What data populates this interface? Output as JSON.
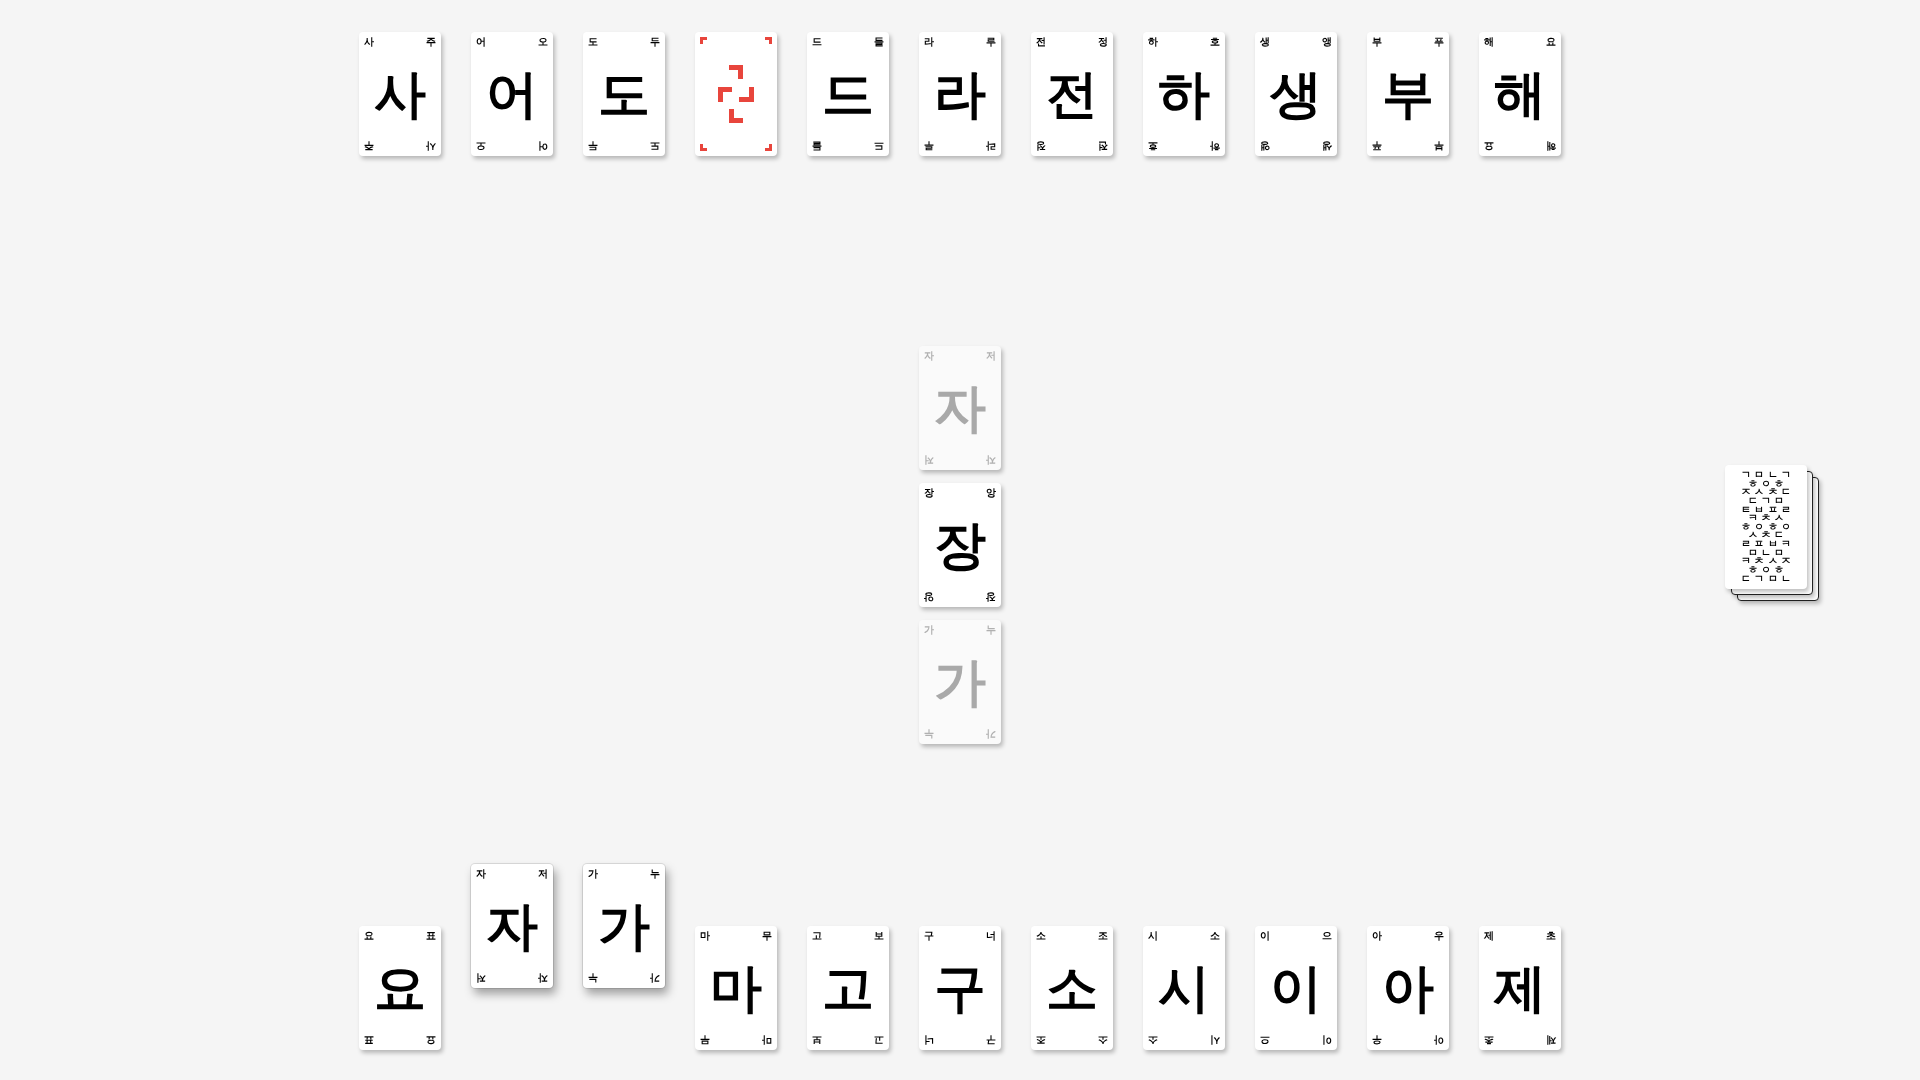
{
  "top_row": [
    {
      "kind": "letter",
      "syllable": "사",
      "corners": [
        "사",
        "주",
        "주",
        "사"
      ]
    },
    {
      "kind": "letter",
      "syllable": "어",
      "corners": [
        "어",
        "오",
        "오",
        "어"
      ]
    },
    {
      "kind": "letter",
      "syllable": "도",
      "corners": [
        "도",
        "두",
        "두",
        "도"
      ]
    },
    {
      "kind": "wild"
    },
    {
      "kind": "letter",
      "syllable": "드",
      "corners": [
        "드",
        "들",
        "들",
        "드"
      ]
    },
    {
      "kind": "letter",
      "syllable": "라",
      "corners": [
        "라",
        "루",
        "루",
        "라"
      ]
    },
    {
      "kind": "letter",
      "syllable": "전",
      "corners": [
        "전",
        "정",
        "정",
        "전"
      ]
    },
    {
      "kind": "letter",
      "syllable": "하",
      "corners": [
        "하",
        "호",
        "호",
        "하"
      ]
    },
    {
      "kind": "letter",
      "syllable": "생",
      "corners": [
        "생",
        "앵",
        "앵",
        "생"
      ]
    },
    {
      "kind": "letter",
      "syllable": "부",
      "corners": [
        "부",
        "푸",
        "푸",
        "부"
      ]
    },
    {
      "kind": "letter",
      "syllable": "해",
      "corners": [
        "해",
        "요",
        "요",
        "해"
      ]
    }
  ],
  "board": [
    {
      "kind": "letter",
      "syllable": "자",
      "corners": [
        "자",
        "저",
        "저",
        "자"
      ],
      "faded": true
    },
    {
      "kind": "letter",
      "syllable": "장",
      "corners": [
        "장",
        "앙",
        "앙",
        "장"
      ],
      "faded": false
    },
    {
      "kind": "letter",
      "syllable": "가",
      "corners": [
        "가",
        "누",
        "누",
        "가"
      ],
      "faded": true
    }
  ],
  "hand": [
    {
      "kind": "letter",
      "syllable": "요",
      "corners": [
        "요",
        "표",
        "표",
        "요"
      ],
      "selected": false
    },
    {
      "kind": "letter",
      "syllable": "자",
      "corners": [
        "자",
        "저",
        "저",
        "자"
      ],
      "selected": true
    },
    {
      "kind": "letter",
      "syllable": "가",
      "corners": [
        "가",
        "누",
        "누",
        "가"
      ],
      "selected": true
    },
    {
      "kind": "letter",
      "syllable": "마",
      "corners": [
        "마",
        "무",
        "무",
        "마"
      ],
      "selected": false
    },
    {
      "kind": "letter",
      "syllable": "고",
      "corners": [
        "고",
        "보",
        "보",
        "고"
      ],
      "selected": false
    },
    {
      "kind": "letter",
      "syllable": "구",
      "corners": [
        "구",
        "너",
        "너",
        "구"
      ],
      "selected": false
    },
    {
      "kind": "letter",
      "syllable": "소",
      "corners": [
        "소",
        "조",
        "조",
        "소"
      ],
      "selected": false
    },
    {
      "kind": "letter",
      "syllable": "시",
      "corners": [
        "시",
        "소",
        "소",
        "시"
      ],
      "selected": false
    },
    {
      "kind": "letter",
      "syllable": "이",
      "corners": [
        "이",
        "으",
        "으",
        "이"
      ],
      "selected": false
    },
    {
      "kind": "letter",
      "syllable": "아",
      "corners": [
        "아",
        "우",
        "우",
        "아"
      ],
      "selected": false
    },
    {
      "kind": "letter",
      "syllable": "제",
      "corners": [
        "제",
        "초",
        "초",
        "제"
      ],
      "selected": false
    }
  ],
  "deck": {
    "pattern": [
      "ㄱ ㅁ ㄴ ㄱ",
      "ㅎ ㅇ ㅎ",
      "ㅈ ㅅ ㅊ ㄷ",
      "ㄷ ㄱ ㅁ",
      "ㅌ ㅂ ㅍ ㄹ",
      "ㅋ ㅊ ㅅ",
      "ㅎ ㅇ ㅎ ㅇ",
      "ㅅ ㅊ ㄷ",
      "ㄹ ㅍ ㅂ ㅋ",
      "ㅁ ㄴ ㅁ",
      "ㅋ ㅊ ㅅ ㅈ",
      "ㅎ ㅇ ㅎ",
      "ㄷ ㄱ ㅁ ㄴ"
    ]
  }
}
